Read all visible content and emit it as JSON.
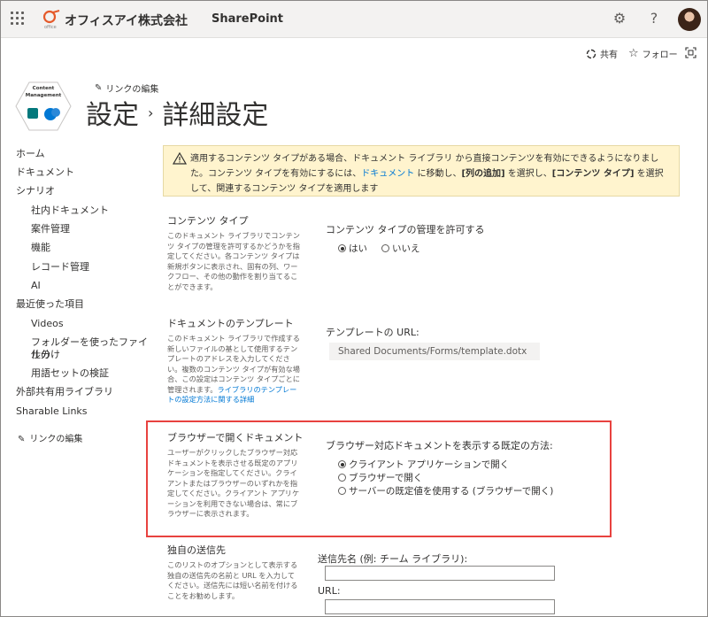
{
  "suite": {
    "org_name": "オフィスアイ株式会社",
    "app_name": "SharePoint",
    "icons": [
      "waffle-icon",
      "gear-icon",
      "help-icon",
      "avatar"
    ]
  },
  "commands": {
    "share": "共有",
    "follow": "フォロー"
  },
  "header": {
    "edit_link": "リンクの編集",
    "breadcrumb_parent": "設定",
    "breadcrumb_current": "詳細設定",
    "logo_text_line1": "Content",
    "logo_text_line2": "Management"
  },
  "nav": {
    "items": [
      {
        "label": "ホーム"
      },
      {
        "label": "ドキュメント"
      },
      {
        "label": "シナリオ"
      },
      {
        "label": "社内ドキュメント"
      },
      {
        "label": "案件管理"
      },
      {
        "label": "機能"
      },
      {
        "label": "レコード管理"
      },
      {
        "label": "AI"
      },
      {
        "label": "最近使った項目"
      },
      {
        "label": "Videos"
      },
      {
        "label": "フォルダーを使ったファイルの"
      },
      {
        "label": "仕分け"
      },
      {
        "label": "用語セットの検証"
      },
      {
        "label": "外部共有用ライブラリ"
      },
      {
        "label": "Sharable Links"
      }
    ],
    "edit_link": "リンクの編集"
  },
  "banner": {
    "part1": "適用するコンテンツ タイプがある場合、ドキュメント ライブラリ から直接コンテンツを有効にできるようになりました。コンテンツ タイプを有効にするには、",
    "link": "ドキュメント",
    "part2": " に移動し、",
    "bold1": "[列の追加]",
    "part3": " を選択し、",
    "bold2": "[コンテンツ タイプ]",
    "part4": " を選択して、関連するコンテンツ タイプを適用します"
  },
  "sections": {
    "content_type": {
      "title": "コンテンツ タイプ",
      "desc": "このドキュメント ライブラリでコンテンツ タイプの管理を許可するかどうかを指定してください。各コンテンツ タイプは新規ボタンに表示され、固有の列、ワークフロー、その他の動作を割り当てることができます。",
      "field_label": "コンテンツ タイプの管理を許可する",
      "options": [
        "はい",
        "いいえ"
      ],
      "selected": "はい"
    },
    "template": {
      "title": "ドキュメントのテンプレート",
      "desc": "このドキュメント ライブラリで作成する新しいファイルの基として使用するテンプレートのアドレスを入力してください。複数のコンテンツ タイプが有効な場合、この設定はコンテンツ タイプごとに管理されます。",
      "desc_link": "ライブラリのテンプレートの設定方法に関する詳細",
      "field_label": "テンプレートの URL:",
      "url_value": "Shared Documents/Forms/template.dotx"
    },
    "browser": {
      "title": "ブラウザーで開くドキュメント",
      "desc": "ユーザーがクリックしたブラウザー対応ドキュメントを表示させる既定のアプリケーションを指定してください。クライアントまたはブラウザーのいずれかを指定してください。クライアント アプリケーションを利用できない場合は、常にブラウザーに表示されます。",
      "field_label": "ブラウザー対応ドキュメントを表示する既定の方法:",
      "options": [
        "クライアント アプリケーションで開く",
        "ブラウザーで開く",
        "サーバーの既定値を使用する (ブラウザーで開く)"
      ],
      "selected": "クライアント アプリケーションで開く"
    },
    "send_to": {
      "title": "独自の送信先",
      "desc": "このリストのオプションとして表示する独自の送信先の名前と URL を入力してください。送信先には短い名前を付けることをお勧めします。",
      "name_label": "送信先名 (例: チーム ライブラリ):",
      "url_label": "URL:"
    }
  },
  "colors": {
    "accent": "#0078d4",
    "warning_bg": "#fff4ce",
    "highlight": "#e8423f"
  }
}
